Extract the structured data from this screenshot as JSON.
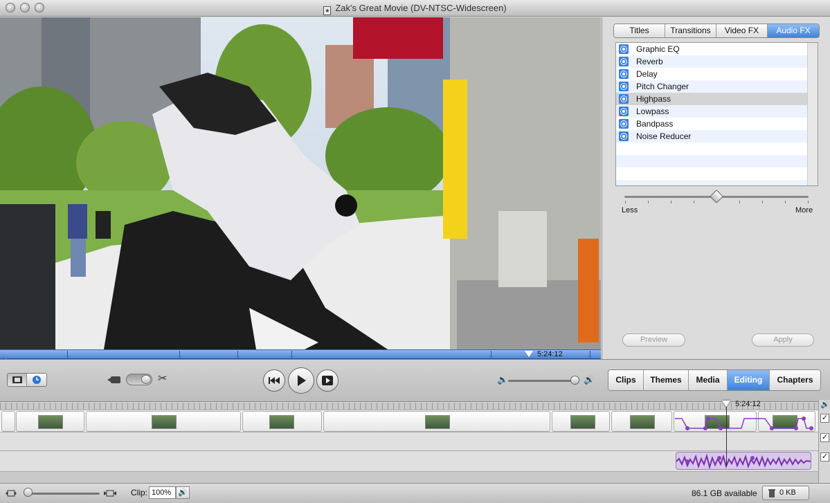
{
  "window": {
    "title": "Zak's Great Movie (DV-NTSC-Widescreen)",
    "doc_icon": "star-document-icon"
  },
  "viewer": {
    "playhead_time": "5:24:12"
  },
  "fx_panel": {
    "tabs": [
      {
        "label": "Titles"
      },
      {
        "label": "Transitions"
      },
      {
        "label": "Video FX"
      },
      {
        "label": "Audio FX",
        "active": true
      }
    ],
    "effects": [
      {
        "name": "Graphic EQ"
      },
      {
        "name": "Reverb"
      },
      {
        "name": "Delay"
      },
      {
        "name": "Pitch Changer"
      },
      {
        "name": "Highpass",
        "selected": true
      },
      {
        "name": "Lowpass"
      },
      {
        "name": "Bandpass"
      },
      {
        "name": "Noise Reducer"
      }
    ],
    "slider": {
      "min_label": "Less",
      "max_label": "More",
      "value_fraction": 0.5
    },
    "preview_label": "Preview",
    "apply_label": "Apply"
  },
  "controls": {
    "volume_fraction": 1.0,
    "panel_tabs": [
      {
        "label": "Clips"
      },
      {
        "label": "Themes"
      },
      {
        "label": "Media"
      },
      {
        "label": "Editing",
        "active": true
      },
      {
        "label": "Chapters"
      }
    ]
  },
  "timeline": {
    "playhead_time": "5:24:12",
    "check_mark": "✓"
  },
  "status": {
    "clip_label": "Clip:",
    "clip_volume": "100%",
    "available": "86.1 GB available",
    "trash": "0 KB"
  },
  "colors": {
    "accent_blue": "#3f82d9",
    "audio_purple": "#8a3fbf"
  }
}
